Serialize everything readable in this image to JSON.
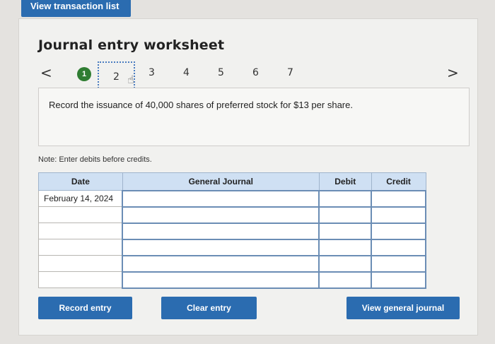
{
  "header": {
    "view_transactions_label": "View transaction list"
  },
  "worksheet": {
    "title": "Journal entry worksheet",
    "steps": [
      "1",
      "2",
      "3",
      "4",
      "5",
      "6",
      "7"
    ],
    "prev_arrow": "<",
    "next_arrow": ">",
    "prompt": "Record the issuance of 40,000 shares of preferred stock for $13 per share.",
    "note": "Note: Enter debits before credits."
  },
  "table": {
    "headers": {
      "date": "Date",
      "general_journal": "General Journal",
      "debit": "Debit",
      "credit": "Credit"
    },
    "rows": [
      {
        "date": "February 14, 2024",
        "account": "",
        "debit": "",
        "credit": ""
      },
      {
        "date": "",
        "account": "",
        "debit": "",
        "credit": ""
      },
      {
        "date": "",
        "account": "",
        "debit": "",
        "credit": ""
      },
      {
        "date": "",
        "account": "",
        "debit": "",
        "credit": ""
      },
      {
        "date": "",
        "account": "",
        "debit": "",
        "credit": ""
      },
      {
        "date": "",
        "account": "",
        "debit": "",
        "credit": ""
      }
    ]
  },
  "actions": {
    "record_label": "Record entry",
    "clear_label": "Clear entry",
    "view_journal_label": "View general journal"
  },
  "colors": {
    "accent": "#2b6cb0",
    "step_done": "#2f7d32",
    "header_bg": "#cfe0f3"
  },
  "icons": {
    "cursor": "hand-pointer-icon"
  }
}
